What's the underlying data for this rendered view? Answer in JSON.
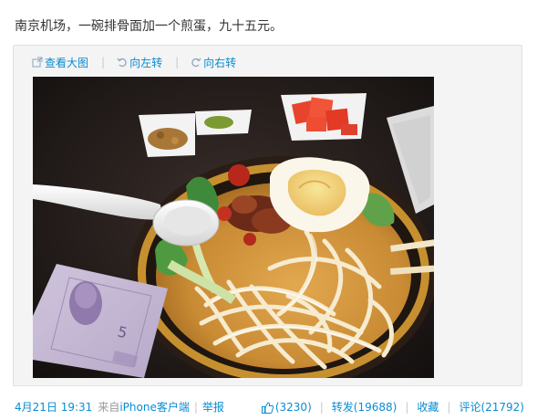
{
  "post": {
    "text": "南京机场，一碗排骨面加一个煎蛋，九十五元。"
  },
  "media": {
    "toolbar": [
      {
        "label": "查看大图",
        "icon": "enlarge-icon"
      },
      {
        "label": "向左转",
        "icon": "rotate-left-icon"
      },
      {
        "label": "向右转",
        "icon": "rotate-right-icon"
      }
    ],
    "separator": "|",
    "photo": {
      "banknote_digit": "5"
    }
  },
  "footer": {
    "date": "4月21日 19:31",
    "source_prefix": "来自",
    "source": "iPhone客户端",
    "report": "举报",
    "like_count": "(3230)",
    "repost": "转发(19688)",
    "favorite": "收藏",
    "comment": "评论(21792)",
    "separator": "|"
  },
  "colors": {
    "link": "#0a8cd2",
    "text": "#333333",
    "muted": "#999999",
    "box_bg": "#f4f4f4",
    "box_border": "#e1e1e1"
  }
}
